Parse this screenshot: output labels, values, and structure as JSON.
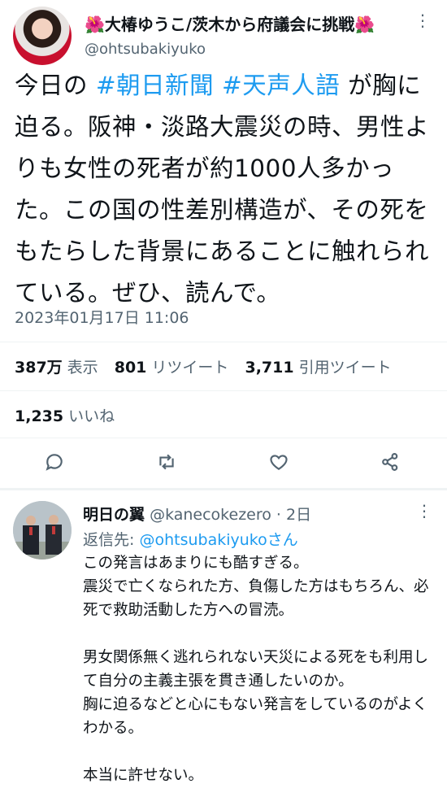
{
  "tweet": {
    "author_name": "大椿ゆうこ/茨木から府議会に挑戦",
    "flower_left": "🌺",
    "flower_right": "🌺",
    "handle": "@ohtsubakiyuko",
    "text_pre": "今日の ",
    "hashtag1": "#朝日新聞",
    "hashtag2": "#天声人語",
    "text_post": " が胸に迫る。阪神・淡路大震災の時、男性よりも女性の死者が約1000人多かった。この国の性差別構造が、その死をもたらした背景にあることに触れられている。ぜひ、読んで。",
    "timestamp": "2023年01月17日 11:06",
    "views_count": "387万",
    "views_label": "表示",
    "retweets_count": "801",
    "retweets_label": "リツイート",
    "quotes_count": "3,711",
    "quotes_label": "引用ツイート",
    "likes_count": "1,235",
    "likes_label": "いいね"
  },
  "reply": {
    "name": "明日の翼",
    "handle": "@kanecokezero",
    "separator": "·",
    "time": "2日",
    "replying_label": "返信先: ",
    "replying_handle": "@ohtsubakiyukoさん",
    "text": "この発言はあまりにも酷すぎる。\n震災で亡くなられた方、負傷した方はもちろん、必死で救助活動した方への冒涜。\n\n男女関係無く逃れられない天災による死をも利用して自分の主義主張を貫き通したいのか。\n胸に迫るなどと心にもない発言をしているのがよくわかる。\n\n本当に許せない。"
  },
  "icons": {
    "more": "more-icon",
    "reply": "reply-icon",
    "retweet": "retweet-icon",
    "like": "heart-icon",
    "share": "share-icon"
  }
}
